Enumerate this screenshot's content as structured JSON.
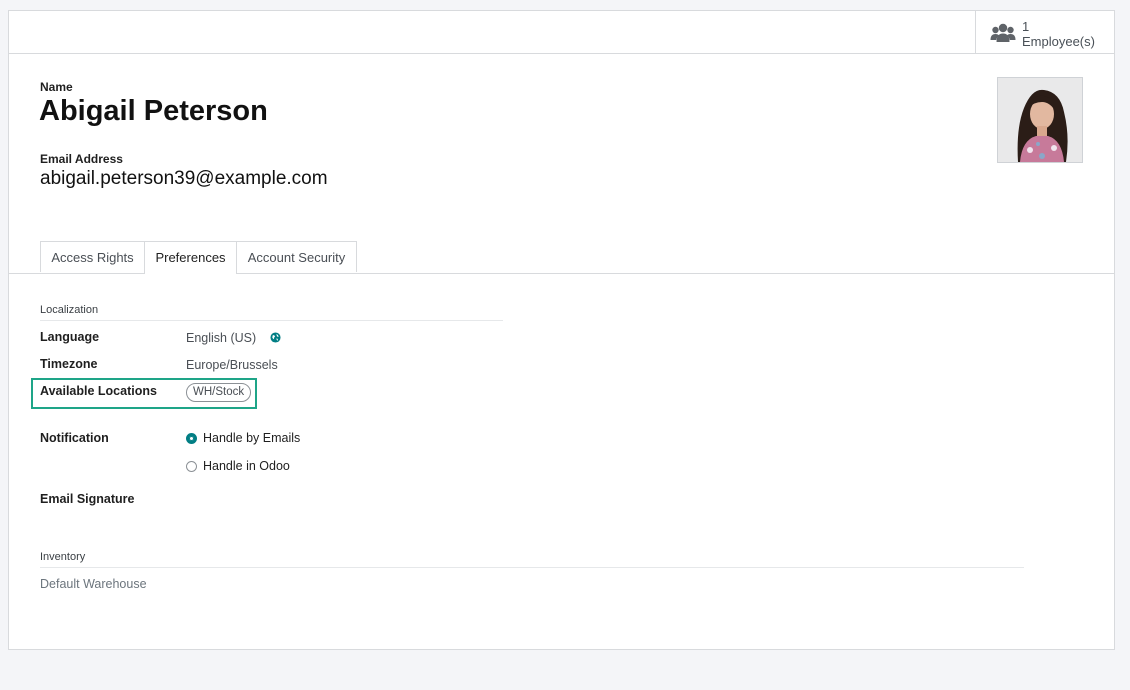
{
  "stat_button": {
    "count": "1",
    "label": "Employee(s)",
    "icon": "users-icon"
  },
  "user": {
    "name_label": "Name",
    "name": "Abigail Peterson",
    "email_label": "Email Address",
    "email": "abigail.peterson39@example.com",
    "avatar_icon": "user-avatar"
  },
  "tabs": [
    {
      "label": "Access Rights",
      "active": false
    },
    {
      "label": "Preferences",
      "active": true
    },
    {
      "label": "Account Security",
      "active": false
    }
  ],
  "localization": {
    "title": "Localization",
    "language_label": "Language",
    "language_value": "English (US)",
    "timezone_label": "Timezone",
    "timezone_value": "Europe/Brussels",
    "locations_label": "Available Locations",
    "locations_tag": "WH/Stock"
  },
  "notification": {
    "label": "Notification",
    "options": [
      {
        "label": "Handle by Emails",
        "selected": true
      },
      {
        "label": "Handle in Odoo",
        "selected": false
      }
    ]
  },
  "signature": {
    "label": "Email Signature"
  },
  "inventory": {
    "title": "Inventory",
    "default_warehouse_label": "Default Warehouse"
  },
  "colors": {
    "accent": "#017e84",
    "highlight": "#1ea588"
  }
}
